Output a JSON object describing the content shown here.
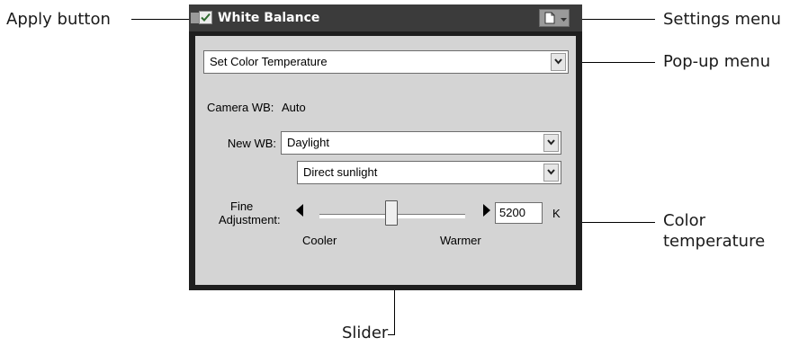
{
  "window": {
    "title": "White Balance"
  },
  "popup": {
    "value": "Set Color Temperature"
  },
  "camera_wb": {
    "label": "Camera WB:",
    "value": "Auto"
  },
  "new_wb": {
    "label": "New WB:",
    "value": "Daylight",
    "sub_value": "Direct sunlight"
  },
  "fine": {
    "label_line1": "Fine",
    "label_line2": "Adjustment:",
    "cooler": "Cooler",
    "warmer": "Warmer",
    "temperature": "5200",
    "unit": "K",
    "slider_fraction": 0.55
  },
  "callouts": {
    "apply": "Apply button",
    "settings": "Settings menu",
    "popup": "Pop-up menu",
    "color_temp_1": "Color",
    "color_temp_2": "temperature",
    "slider": "Slider"
  },
  "colors": {
    "titlebar": "#3b3b3b",
    "panel": "#d4d4d4",
    "frame": "#1e1e1e"
  },
  "icons": [
    "checkbox-check-icon",
    "document-icon",
    "dropdown-arrow-icon",
    "left-arrow-icon",
    "right-arrow-icon"
  ]
}
